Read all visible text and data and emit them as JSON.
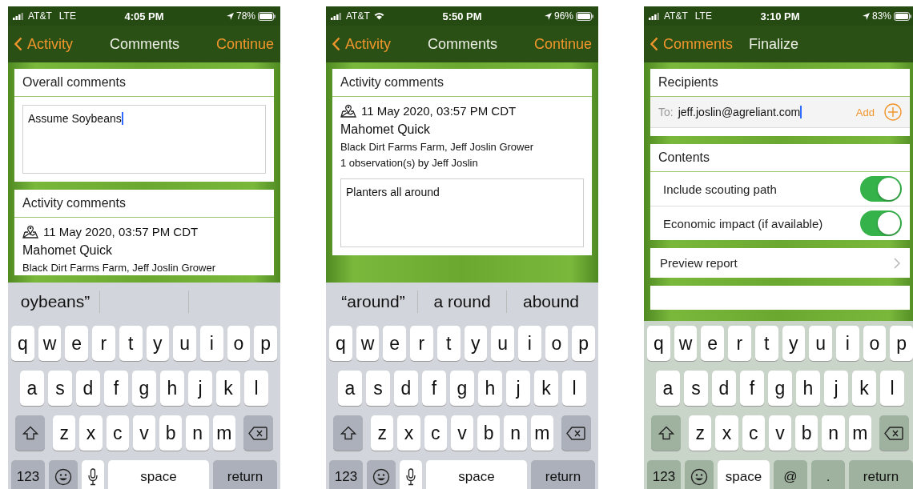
{
  "phones": [
    {
      "status": {
        "carrier": "AT&T",
        "network": {
          "kind": "text",
          "label": "LTE"
        },
        "time": "4:05 PM",
        "battery": "78%"
      },
      "nav": {
        "back": "Activity",
        "title": "Comments",
        "action": "Continue"
      },
      "sections": [
        {
          "header": "Overall comments",
          "items": [
            {
              "kind": "textarea",
              "value": "Assume Soybeans",
              "focused": true
            }
          ]
        },
        {
          "header": "Activity comments",
          "items": [
            {
              "kind": "activity",
              "date": "11 May 2020, 03:57 PM CDT",
              "title": "Mahomet Quick",
              "subtitle": "Black Dirt Farms Farm, Jeff Joslin Grower"
            }
          ]
        }
      ],
      "keyboard": {
        "suggestions": [
          "oybeans”"
        ],
        "rows": [
          [
            "q",
            "w",
            "e",
            "r",
            "t",
            "y",
            "u",
            "i",
            "o",
            "p"
          ],
          [
            "a",
            "s",
            "d",
            "f",
            "g",
            "h",
            "j",
            "k",
            "l"
          ],
          [
            "z",
            "x",
            "c",
            "v",
            "b",
            "n",
            "m"
          ]
        ],
        "bottom": [
          {
            "kind": "text",
            "label": "123"
          },
          {
            "kind": "emoji"
          },
          {
            "kind": "mic"
          },
          {
            "kind": "space",
            "label": "space"
          },
          {
            "kind": "text",
            "label": "return"
          }
        ]
      }
    },
    {
      "status": {
        "carrier": "AT&T",
        "network": {
          "kind": "wifi"
        },
        "time": "5:50 PM",
        "battery": "96%"
      },
      "nav": {
        "back": "Activity",
        "title": "Comments",
        "action": "Continue"
      },
      "sections": [
        {
          "header": "Activity comments",
          "items": [
            {
              "kind": "activity",
              "date": "11 May 2020, 03:57 PM CDT",
              "title": "Mahomet Quick",
              "subtitle": "Black Dirt Farms Farm, Jeff Joslin Grower",
              "detail": "1 observation(s) by Jeff Joslin"
            },
            {
              "kind": "textarea",
              "value": "Planters all around",
              "focused": false
            }
          ]
        }
      ],
      "keyboard": {
        "suggestions": [
          "“around”",
          "a round",
          "abound"
        ],
        "rows": [
          [
            "q",
            "w",
            "e",
            "r",
            "t",
            "y",
            "u",
            "i",
            "o",
            "p"
          ],
          [
            "a",
            "s",
            "d",
            "f",
            "g",
            "h",
            "j",
            "k",
            "l"
          ],
          [
            "z",
            "x",
            "c",
            "v",
            "b",
            "n",
            "m"
          ]
        ],
        "bottom": [
          {
            "kind": "text",
            "label": "123"
          },
          {
            "kind": "emoji"
          },
          {
            "kind": "mic"
          },
          {
            "kind": "space",
            "label": "space"
          },
          {
            "kind": "text",
            "label": "return"
          }
        ]
      }
    },
    {
      "status": {
        "carrier": "AT&T",
        "network": {
          "kind": "text",
          "label": "LTE"
        },
        "time": "3:10 PM",
        "battery": "83%"
      },
      "nav": {
        "back": "Comments",
        "title": "Finalize"
      },
      "sections": [
        {
          "header": "Recipients",
          "items": [
            {
              "kind": "recipient",
              "prefix": "To:",
              "value": "jeff.joslin@agreliant.com",
              "focused": true,
              "action": "Add"
            }
          ]
        },
        {
          "header": "Contents",
          "items": [
            {
              "kind": "toggle",
              "label": "Include scouting path",
              "on": true
            },
            {
              "kind": "toggle",
              "label": "Economic impact (if available)",
              "on": true
            }
          ]
        },
        {
          "items": [
            {
              "kind": "link",
              "label": "Preview report"
            }
          ]
        },
        {
          "items": [
            {
              "kind": "blank"
            }
          ]
        }
      ],
      "keyboard": {
        "rows": [
          [
            "q",
            "w",
            "e",
            "r",
            "t",
            "y",
            "u",
            "i",
            "o",
            "p"
          ],
          [
            "a",
            "s",
            "d",
            "f",
            "g",
            "h",
            "j",
            "k",
            "l"
          ],
          [
            "z",
            "x",
            "c",
            "v",
            "b",
            "n",
            "m"
          ]
        ],
        "bottom": [
          {
            "kind": "text",
            "label": "123"
          },
          {
            "kind": "emoji"
          },
          {
            "kind": "space",
            "label": "space"
          },
          {
            "kind": "text",
            "label": "@"
          },
          {
            "kind": "text",
            "label": "."
          },
          {
            "kind": "text",
            "label": "return"
          }
        ]
      }
    }
  ]
}
